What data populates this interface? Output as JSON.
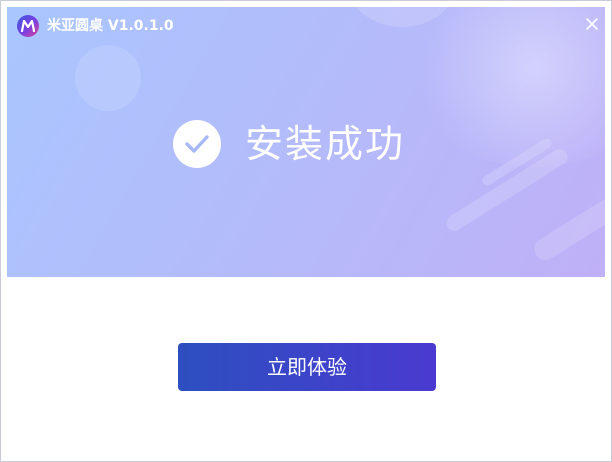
{
  "window": {
    "title": "米亚圆桌 V1.0.1.0"
  },
  "status": {
    "message": "安装成功",
    "icon": "check-circle-icon"
  },
  "actions": {
    "primary_label": "立即体验"
  },
  "icons": {
    "app_logo": "miya-logo-icon",
    "close": "close-icon"
  },
  "colors": {
    "hero_gradient_start": "#a9c6ff",
    "hero_gradient_end": "#bfb0f7",
    "button_gradient_start": "#2d4fc0",
    "button_gradient_end": "#4a3ad0",
    "check_color": "#a8b8f4"
  }
}
